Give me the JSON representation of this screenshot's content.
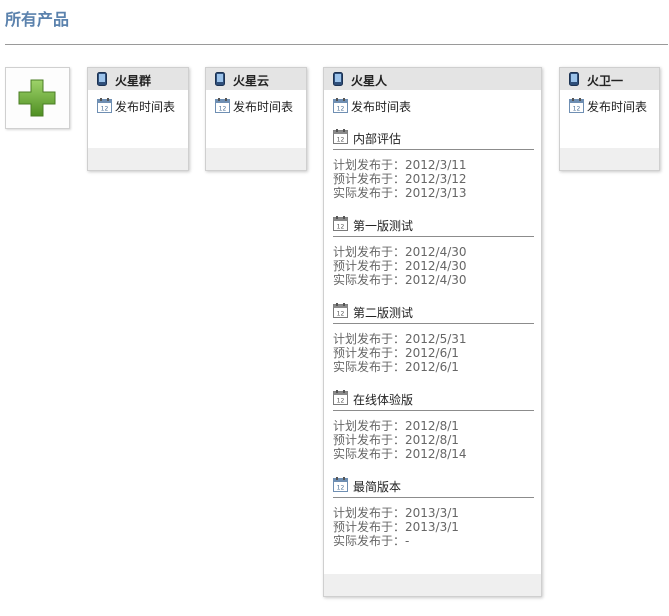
{
  "page": {
    "title": "所有产品"
  },
  "products": [
    {
      "name": "火星群",
      "schedule_label": "发布时间表",
      "releases": []
    },
    {
      "name": "火星云",
      "schedule_label": "发布时间表",
      "releases": []
    },
    {
      "name": "火星人",
      "schedule_label": "发布时间表",
      "releases": [
        {
          "name": "内部评估",
          "planned": "计划发布于：2012/3/11",
          "estimated": "预计发布于：2012/3/12",
          "actual": "实际发布于：2012/3/13"
        },
        {
          "name": "第一版测试",
          "planned": "计划发布于：2012/4/30",
          "estimated": "预计发布于：2012/4/30",
          "actual": "实际发布于：2012/4/30"
        },
        {
          "name": "第二版测试",
          "planned": "计划发布于：2012/5/31",
          "estimated": "预计发布于：2012/6/1",
          "actual": "实际发布于：2012/6/1"
        },
        {
          "name": "在线体验版",
          "planned": "计划发布于：2012/8/1",
          "estimated": "预计发布于：2012/8/1",
          "actual": "实际发布于：2012/8/14"
        },
        {
          "name": "最简版本",
          "planned": "计划发布于：2013/3/1",
          "estimated": "预计发布于：2013/3/1",
          "actual": "实际发布于：-"
        }
      ]
    },
    {
      "name": "火卫一",
      "schedule_label": "发布时间表",
      "releases": []
    }
  ],
  "icons": {
    "add": "plus-icon",
    "product": "phone-icon",
    "schedule": "calendar-icon",
    "release": "calendar-icon"
  },
  "colors": {
    "title": "#5b82ad",
    "add_green": "#6aa83a",
    "card_header": "#e4e4e4",
    "date_text": "#666666"
  }
}
